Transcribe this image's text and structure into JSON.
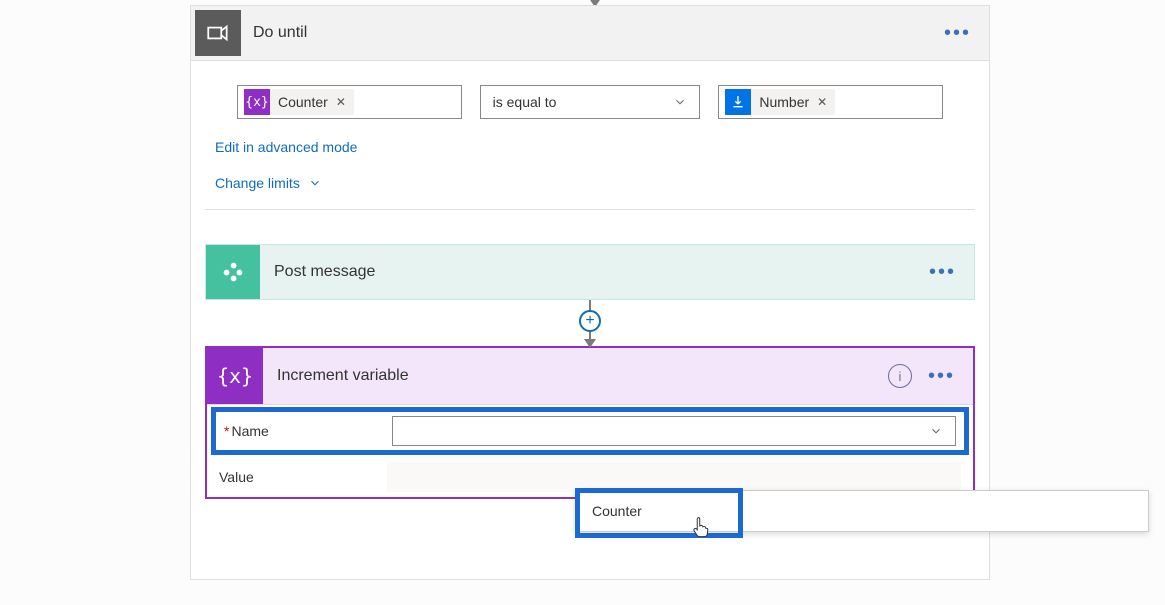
{
  "doUntil": {
    "title": "Do until",
    "left": {
      "token": "Counter"
    },
    "operator": "is equal to",
    "right": {
      "token": "Number"
    },
    "advancedLink": "Edit in advanced mode",
    "limitsLink": "Change limits"
  },
  "postMessage": {
    "title": "Post message"
  },
  "incrementVar": {
    "title": "Increment variable",
    "nameLabel": "Name",
    "valueLabel": "Value",
    "dropdown": {
      "option": "Counter"
    }
  }
}
